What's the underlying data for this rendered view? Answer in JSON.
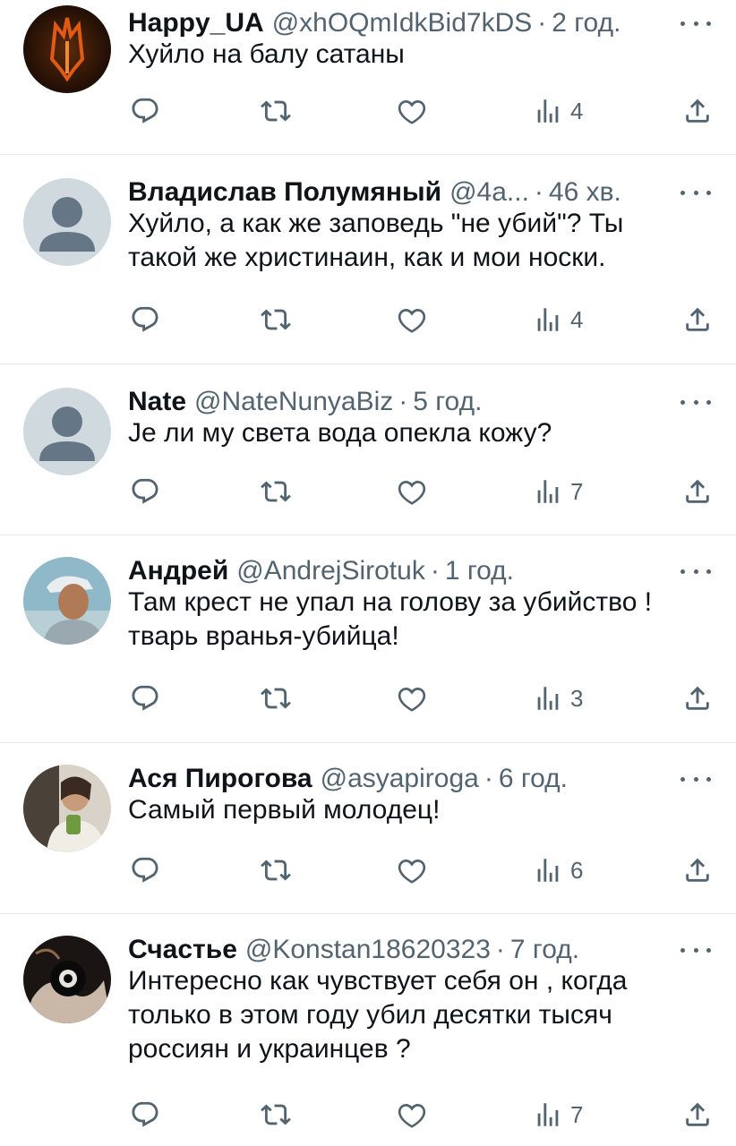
{
  "tweets": [
    {
      "name": "Happy_UA",
      "handle": "@xhOQmIdkBid7kDS",
      "time": "2 год.",
      "lines": [
        "Хуйло на балу сатаны"
      ],
      "views": "4",
      "avatar": "trident-avatar"
    },
    {
      "name": "Владислав Полумяный",
      "handle": "@4a...",
      "time": "46 хв.",
      "lines": [
        "Хуйло, а как же заповедь \"не убий\"? Ты",
        "такой же христинаин, как и мои носки."
      ],
      "views": "4",
      "avatar": "default-avatar"
    },
    {
      "name": "Nate",
      "handle": "@NateNunyaBiz",
      "time": "5 год.",
      "lines": [
        "Је ли му света вода опекла кожу?"
      ],
      "views": "7",
      "avatar": "default-avatar"
    },
    {
      "name": "Андрей",
      "handle": "@AndrejSirotuk",
      "time": "1 год.",
      "lines": [
        "Там крест не упал на голову за убийство !",
        "тварь вранья-убийца!"
      ],
      "views": "3",
      "avatar": "photo-avatar"
    },
    {
      "name": "Ася Пирогова",
      "handle": "@asyapiroga",
      "time": "6 год.",
      "lines": [
        "Самый первый молодец!"
      ],
      "views": "6",
      "avatar": "photo-avatar"
    },
    {
      "name": "Счастье",
      "handle": "@Konstan18620323",
      "time": "7 год.",
      "lines": [
        "Интересно как чувствует себя он , когда",
        "только в этом году убил десятки тысяч",
        "россиян  и украинцев ?"
      ],
      "views": "7",
      "avatar": "photo-avatar"
    }
  ],
  "icons": {
    "reply": "reply-icon",
    "retweet": "retweet-icon",
    "like": "like-icon",
    "views": "views-icon",
    "share": "share-icon",
    "more": "more-icon"
  },
  "colors": {
    "text": "#0f1419",
    "secondary": "#536471",
    "divider": "#e6e9ec",
    "background": "#ffffff"
  }
}
